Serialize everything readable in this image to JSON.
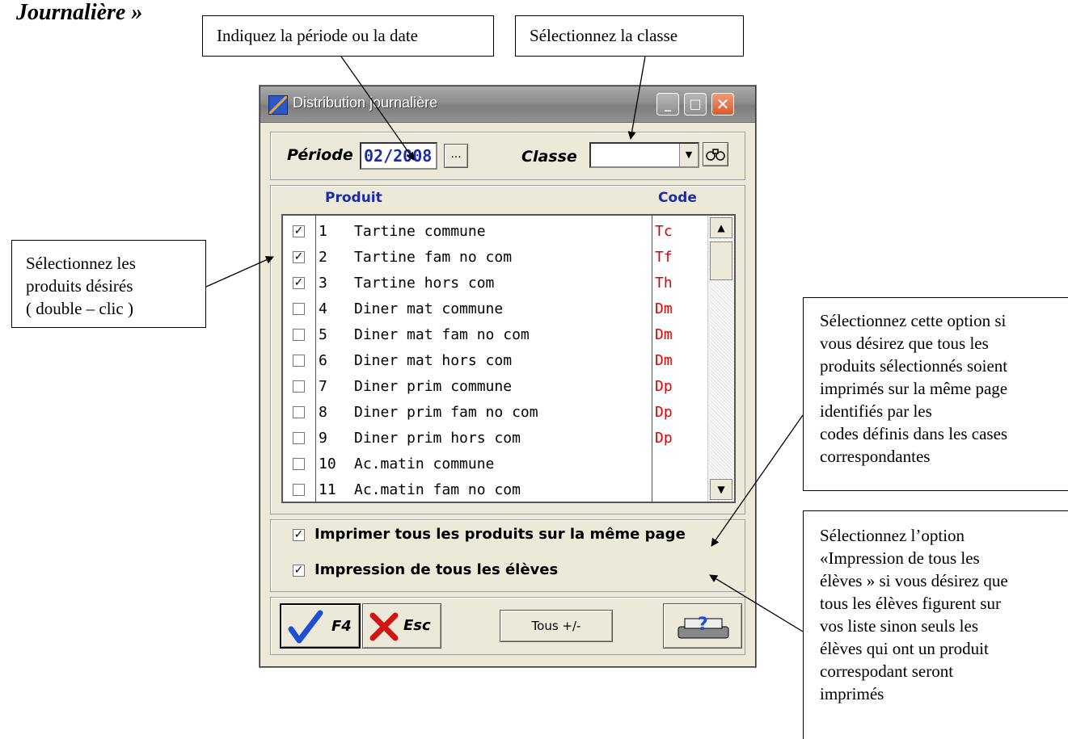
{
  "heading": "Journalière »",
  "callouts": {
    "period": "Indiquez la période ou la date",
    "classe": "Sélectionnez la classe",
    "produits": [
      "Sélectionnez les",
      "produits désirés",
      "( double – clic )"
    ],
    "option1": [
      "Sélectionnez cette option si",
      "vous désirez que tous les",
      "produits sélectionnés soient",
      "imprimés sur la même page",
      "identifiés par les",
      "codes définis dans les cases",
      "correspondantes"
    ],
    "option2": [
      "Sélectionnez l’option",
      "«Impression de tous les",
      "élèves » si vous désirez que",
      "tous les élèves figurent sur",
      "vos liste sinon seuls les",
      "élèves qui ont un produit",
      "correspodant seront",
      "imprimés"
    ]
  },
  "window": {
    "title": "Distribution journalière",
    "minimize": "_",
    "maximize": "□",
    "close": "✕"
  },
  "filters": {
    "period_label": "Période",
    "period_value": "02/2008",
    "browse_label": "...",
    "classe_label": "Classe",
    "classe_value": ""
  },
  "columns": {
    "produit": "Produit",
    "code": "Code"
  },
  "products": [
    {
      "checked": true,
      "num": "1",
      "name": "Tartine commune",
      "code": "Tc"
    },
    {
      "checked": true,
      "num": "2",
      "name": "Tartine fam no com",
      "code": "Tf"
    },
    {
      "checked": true,
      "num": "3",
      "name": "Tartine hors com",
      "code": "Th"
    },
    {
      "checked": false,
      "num": "4",
      "name": "Diner mat commune",
      "code": "Dm"
    },
    {
      "checked": false,
      "num": "5",
      "name": "Diner mat fam no com",
      "code": "Dm"
    },
    {
      "checked": false,
      "num": "6",
      "name": "Diner mat hors com",
      "code": "Dm"
    },
    {
      "checked": false,
      "num": "7",
      "name": "Diner prim commune",
      "code": "Dp"
    },
    {
      "checked": false,
      "num": "8",
      "name": "Diner prim fam no com",
      "code": "Dp"
    },
    {
      "checked": false,
      "num": "9",
      "name": "Diner prim hors com",
      "code": "Dp"
    },
    {
      "checked": false,
      "num": "10",
      "name": "Ac.matin commune",
      "code": ""
    },
    {
      "checked": false,
      "num": "11",
      "name": "Ac.matin fam no com",
      "code": ""
    }
  ],
  "options": {
    "same_page": {
      "checked": true,
      "label": "Imprimer tous les produits sur la même page"
    },
    "all_students": {
      "checked": true,
      "label": "Impression de tous les élèves"
    }
  },
  "buttons": {
    "ok_key": "F4",
    "cancel_key": "Esc",
    "toggle_all": "Tous +/-"
  },
  "colors": {
    "title_blue": "#1c2ba8",
    "code_red": "#e00000"
  }
}
